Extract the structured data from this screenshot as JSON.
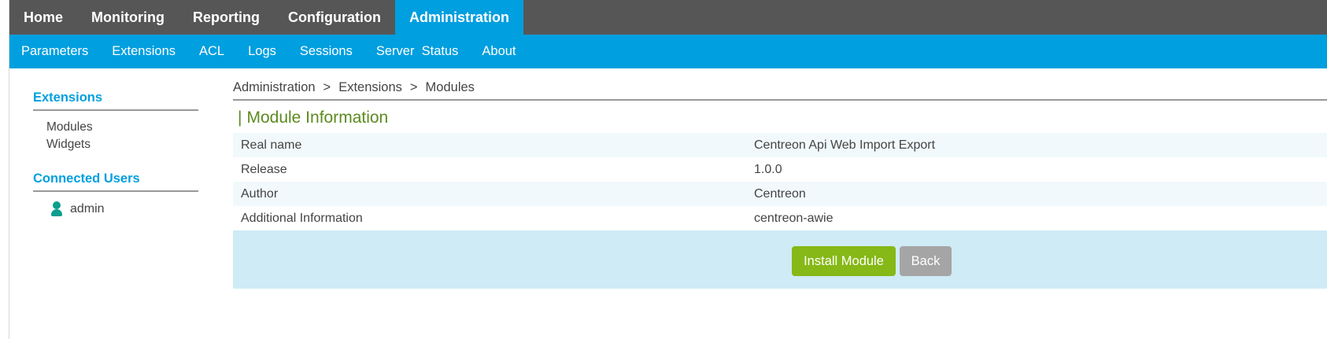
{
  "topnav": {
    "tabs": [
      "Home",
      "Monitoring",
      "Reporting",
      "Configuration",
      "Administration"
    ],
    "active": "Administration"
  },
  "subnav": {
    "items": [
      "Parameters",
      "Extensions",
      "ACL",
      "Logs",
      "Sessions",
      "Server  Status",
      "About"
    ]
  },
  "sidebar": {
    "extensions_title": "Extensions",
    "extensions_items": [
      "Modules",
      "Widgets"
    ],
    "users_title": "Connected Users",
    "users": [
      "admin"
    ]
  },
  "breadcrumb": {
    "items": [
      "Administration",
      "Extensions",
      "Modules"
    ],
    "separator": ">"
  },
  "module_info": {
    "title_bar": "|",
    "title": "Module Information",
    "rows": [
      {
        "label": "Real name",
        "value": "Centreon Api Web Import Export"
      },
      {
        "label": "Release",
        "value": "1.0.0"
      },
      {
        "label": "Author",
        "value": "Centreon"
      },
      {
        "label": "Additional Information",
        "value": "centreon-awie"
      }
    ]
  },
  "actions": {
    "install_label": "Install Module",
    "back_label": "Back"
  },
  "colors": {
    "topbar": "#575657",
    "accent": "#009fdf",
    "title_green": "#5d8a1f",
    "install_button": "#86b817",
    "back_button": "#a5a5a5",
    "action_bar": "#cfebf6",
    "user_icon": "#0b9e8e"
  }
}
